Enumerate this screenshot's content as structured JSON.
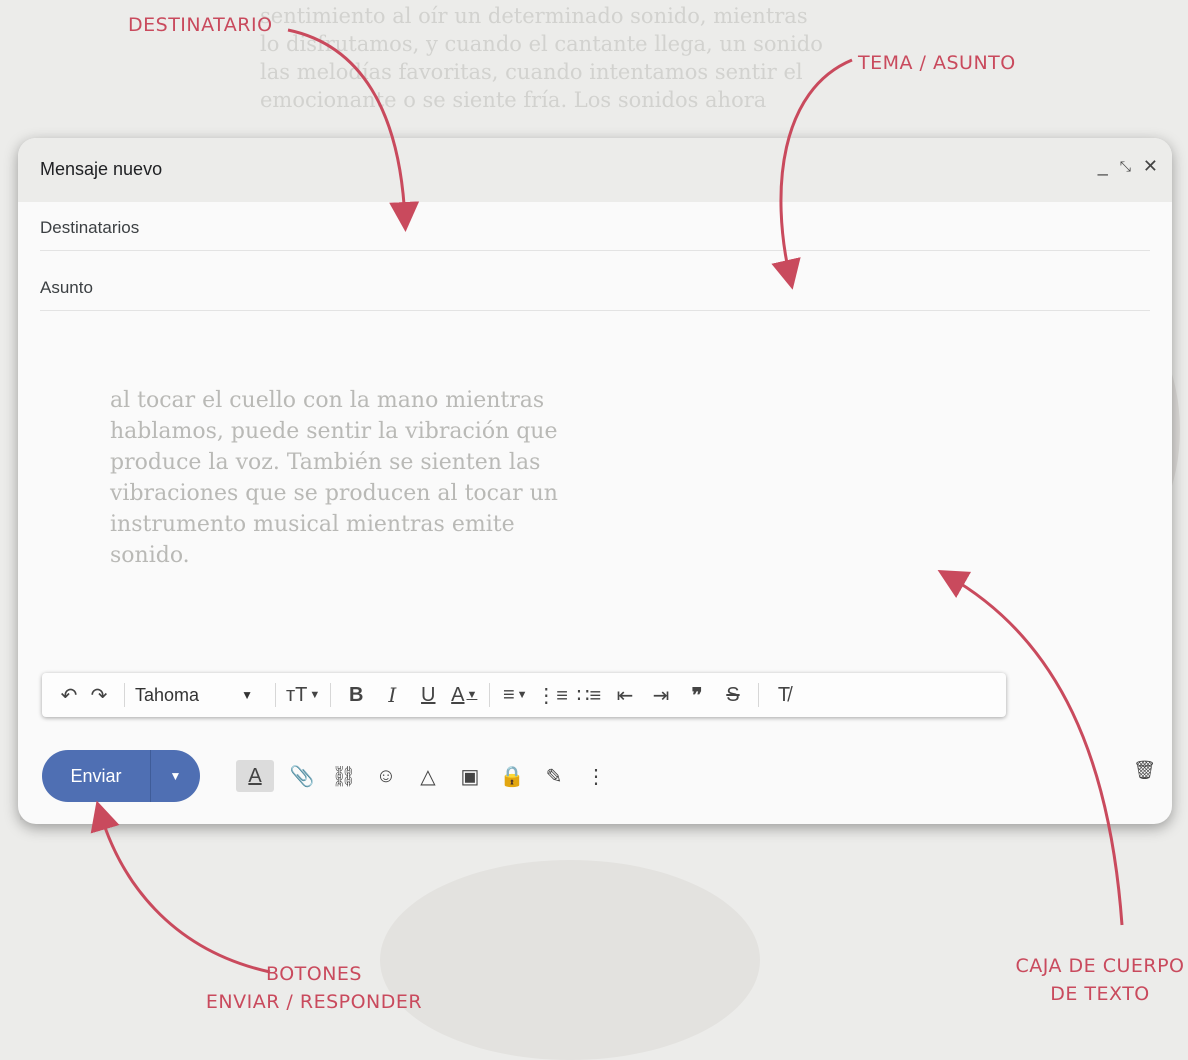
{
  "compose": {
    "title": "Mensaje nuevo",
    "minimize_icon": "minimize-icon",
    "expand_icon": "expand-icon",
    "close_icon": "close-icon",
    "to_placeholder": "Destinatarios",
    "subject_placeholder": "Asunto"
  },
  "toolbar": {
    "font_name": "Tahoma",
    "icons": [
      "undo-icon",
      "redo-icon",
      "font-size-icon",
      "bold-icon",
      "italic-icon",
      "underline-icon",
      "text-color-icon",
      "align-icon",
      "numbered-list-icon",
      "bulleted-list-icon",
      "indent-less-icon",
      "indent-more-icon",
      "quote-icon",
      "strikethrough-icon",
      "remove-formatting-icon"
    ]
  },
  "bottom": {
    "send_label": "Enviar",
    "icons": [
      "formatting-options-icon",
      "attach-icon",
      "link-icon",
      "emoji-icon",
      "drive-icon",
      "photo-icon",
      "confidential-icon",
      "signature-icon",
      "more-options-icon",
      "trash-icon"
    ]
  },
  "annotations": {
    "recipient": "Destinatario",
    "subject": "Tema / asunto",
    "buttons_line1": "Botones",
    "buttons_line2": "Enviar / Responder",
    "body_line1": "Caja de cuerpo",
    "body_line2": "de texto"
  },
  "colors": {
    "send_button": "#4f6fb3",
    "annotation": "#c94a5d",
    "window_bg": "#fafafa"
  }
}
